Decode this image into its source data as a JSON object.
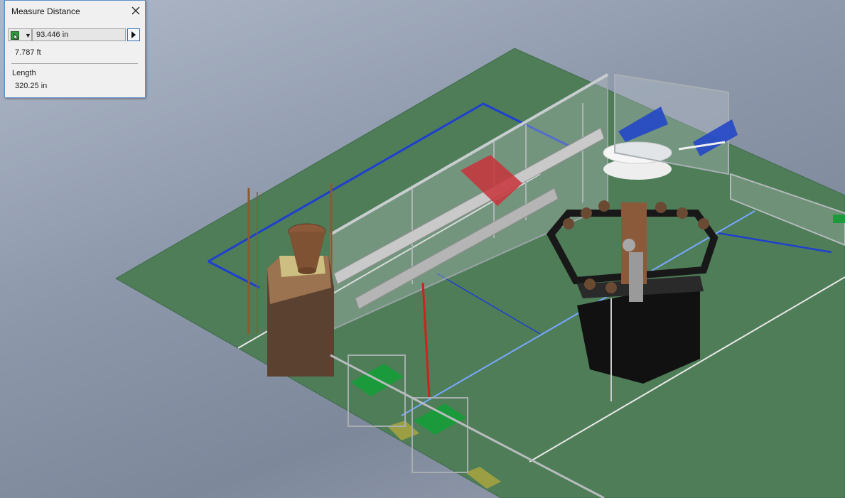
{
  "dialog": {
    "title": "Measure Distance",
    "close_icon": "close-icon",
    "tool_icon": "measure-tool-icon",
    "distance_value": "93.446 in",
    "alternate_units_value": "7.787 ft",
    "length_label": "Length",
    "length_value": "320.25 in"
  },
  "scene": {
    "background_top": "#aeb8c8",
    "floor_color": "#4e7d58",
    "selection_color": "#1f3fd0",
    "measure_line_color": "#d02020",
    "highlight_line_color": "#7aa8ff"
  }
}
